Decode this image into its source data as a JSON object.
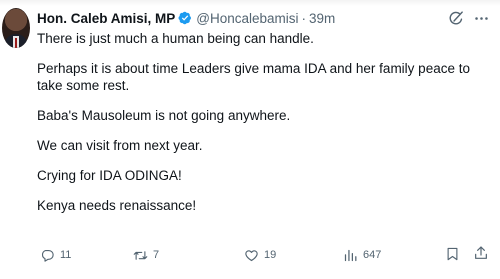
{
  "tweet": {
    "author_name": "Hon. Caleb Amisi, MP",
    "handle": "@Honcalebamisi",
    "separator": "·",
    "time": "39m",
    "paragraphs": [
      "There is just much a human being can handle.",
      "Perhaps it is about time Leaders give mama IDA and her family peace to take some rest.",
      "Baba's Mausoleum is not going anywhere.",
      "We can visit from next year.",
      "Crying for IDA ODINGA!",
      "Kenya needs renaissance!"
    ],
    "actions": {
      "replies": "11",
      "reposts": "7",
      "likes": "19",
      "views": "647"
    }
  },
  "colors": {
    "text": "#0f1419",
    "secondary": "#536471",
    "verified_blue": "#1d9bf0"
  },
  "icons": {
    "verified": "verified-badge-icon",
    "grok": "grok-icon",
    "more": "more-icon",
    "reply": "reply-icon",
    "repost": "repost-icon",
    "like": "heart-icon",
    "views": "views-icon",
    "bookmark": "bookmark-icon",
    "share": "share-icon"
  }
}
